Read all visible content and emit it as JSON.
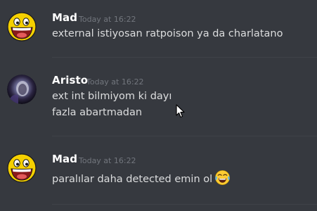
{
  "messages": [
    {
      "username": "Mad",
      "timestamp": "Today at 16:22",
      "avatar": "awesome-face",
      "lines": [
        "external istiyosan ratpoison ya da charlatano"
      ]
    },
    {
      "username": "Aristo",
      "timestamp": "Today at 16:22",
      "avatar": "dark-portrait",
      "lines": [
        "ext int bilmiyom ki dayı",
        "fazla abartmadan"
      ]
    },
    {
      "username": "Mad",
      "timestamp": "Today at 16:22",
      "avatar": "awesome-face",
      "lines": [
        "paralılar daha detected emin ol"
      ],
      "trailing_emoji": "tears-of-joy"
    }
  ],
  "colors": {
    "background": "#36393f",
    "username": "#ffffff",
    "timestamp": "#72767d",
    "message_text": "#dcddde",
    "divider": "#3f4248"
  }
}
